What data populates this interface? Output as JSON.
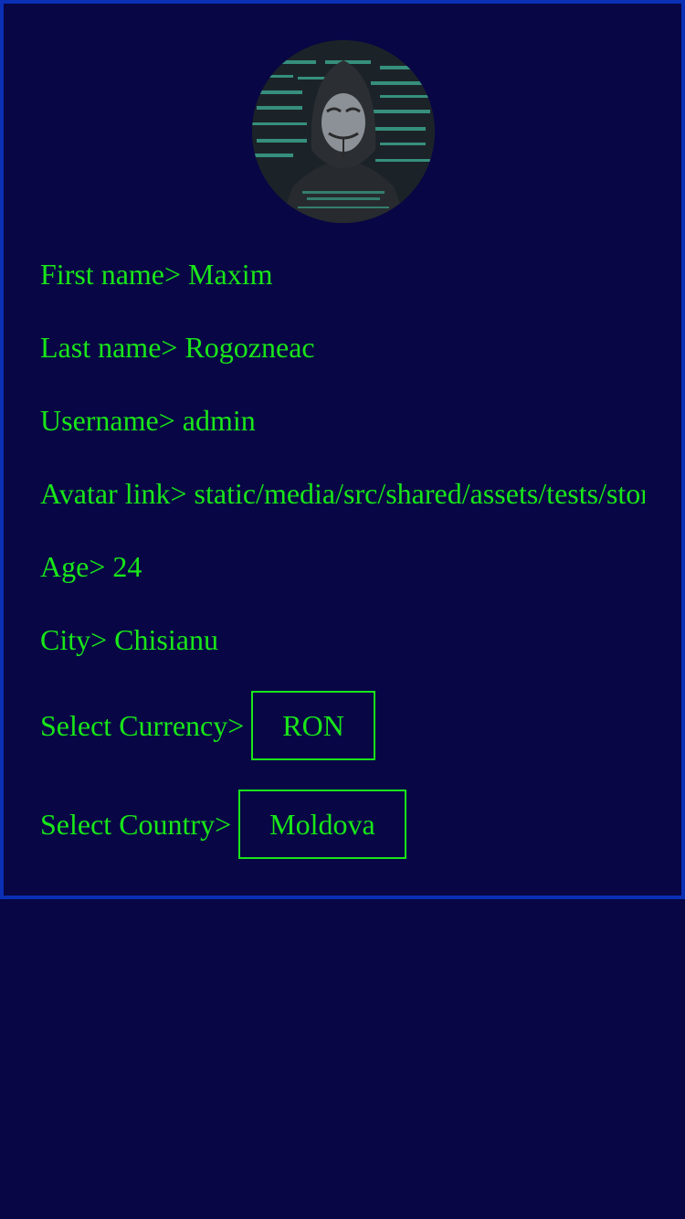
{
  "theme": {
    "background": "#080645",
    "text": "#19e619",
    "border": "#0b2fb5"
  },
  "profile": {
    "avatar_icon": "hooded-figure-mask-avatar",
    "first_name_label": "First name>",
    "first_name": "Maxim",
    "last_name_label": "Last name>",
    "last_name": "Rogozneac",
    "username_label": "Username>",
    "username": "admin",
    "avatar_link_label": "Avatar link>",
    "avatar_link": "static/media/src/shared/assets/tests/stor",
    "age_label": "Age>",
    "age": "24",
    "city_label": "City>",
    "city": "Chisianu",
    "currency_label": "Select Currency>",
    "currency": "RON",
    "country_label": "Select Country>",
    "country": "Moldova"
  }
}
